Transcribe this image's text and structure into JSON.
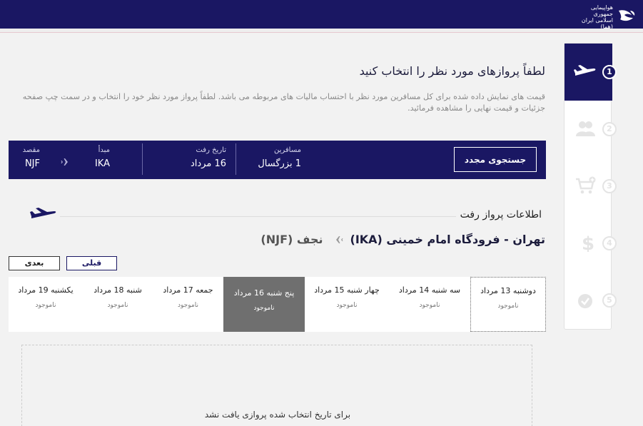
{
  "header": {
    "logo_text": "هواپیمایی جمهوری اسلامی ایران (هما)"
  },
  "page": {
    "title": "لطفاً پروازهای مورد نظر را انتخاب کنید",
    "description": "قیمت های نمایش داده شده برای کل مسافرین مورد نظر با احتساب مالیات های مربوطه می باشد. لطفاً پرواز مورد نظر خود را انتخاب و در سمت چپ صفحه جزئیات و قیمت نهایی را مشاهده فرمائید."
  },
  "search": {
    "button_label": "جستجوی مجدد",
    "passengers_label": "مسافرین",
    "passengers_value": "1 بزرگسال",
    "date_label": "تاریخ رفت",
    "date_value": "16 مرداد",
    "origin_label": "مبدأ",
    "origin_value": "IKA",
    "destination_label": "مقصد",
    "destination_value": "NJF"
  },
  "section": {
    "title": "اطلاعات پرواز رفت"
  },
  "route": {
    "origin": "تهران - فرودگاه امام خمینی (IKA)",
    "destination": "نجف (NJF)"
  },
  "pager": {
    "prev_label": "قبلی",
    "next_label": "بعدی"
  },
  "days": [
    {
      "name": "دوشنبه 13 مرداد",
      "status": "ناموجود"
    },
    {
      "name": "سه شنبه 14 مرداد",
      "status": "ناموجود"
    },
    {
      "name": "چهار شنبه 15 مرداد",
      "status": "ناموجود"
    },
    {
      "name": "پنج شنبه 16 مرداد",
      "status": "ناموجود"
    },
    {
      "name": "جمعه 17 مرداد",
      "status": "ناموجود"
    },
    {
      "name": "شنبه 18 مرداد",
      "status": "ناموجود"
    },
    {
      "name": "یکشنبه 19 مرداد",
      "status": "ناموجود"
    }
  ],
  "results": {
    "empty_message": "برای تاریخ انتخاب شده پروازی یافت نشد"
  },
  "steps": [
    {
      "number": "1",
      "icon": "plane-icon",
      "active": true
    },
    {
      "number": "2",
      "icon": "passengers-icon",
      "active": false
    },
    {
      "number": "3",
      "icon": "cart-add-icon",
      "active": false
    },
    {
      "number": "4",
      "icon": "dollar-icon",
      "active": false
    },
    {
      "number": "5",
      "icon": "check-circle-icon",
      "active": false
    }
  ],
  "colors": {
    "brand": "#1a1763",
    "selected_day": "#6f6f6f",
    "inactive_step": "#e4e4e4"
  }
}
